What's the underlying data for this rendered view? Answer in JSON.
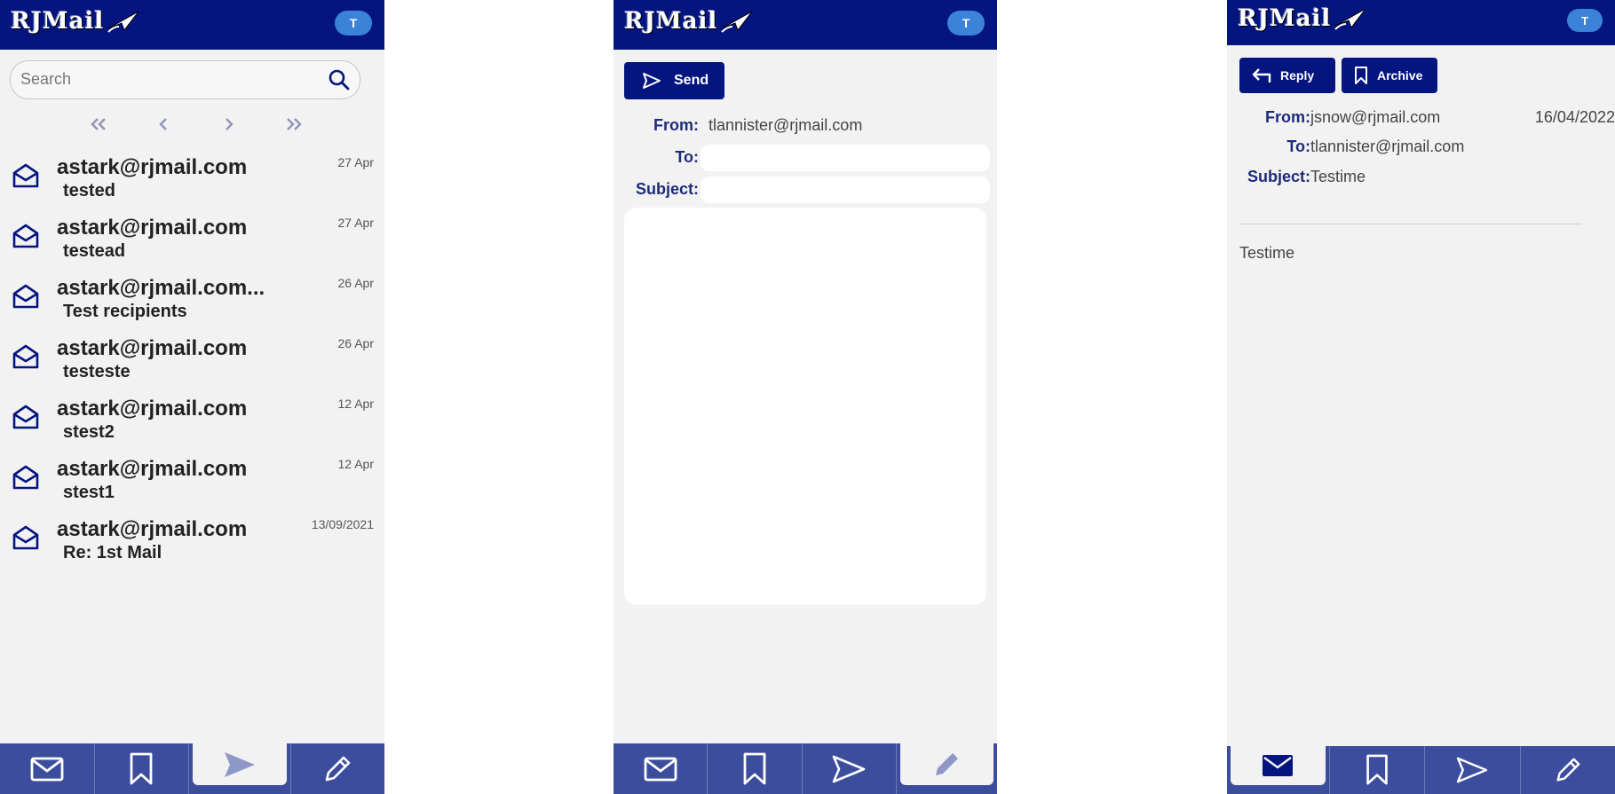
{
  "app": {
    "name": "RJMail",
    "avatar_initial": "T"
  },
  "inbox": {
    "search_placeholder": "Search",
    "messages": [
      {
        "from": "astark@rjmail.com",
        "subject": "tested",
        "date": "27 Apr"
      },
      {
        "from": "astark@rjmail.com",
        "subject": "testead",
        "date": "27 Apr"
      },
      {
        "from": "astark@rjmail.com...",
        "subject": "Test recipients",
        "date": "26 Apr"
      },
      {
        "from": "astark@rjmail.com",
        "subject": "testeste",
        "date": "26 Apr"
      },
      {
        "from": "astark@rjmail.com",
        "subject": "stest2",
        "date": "12 Apr"
      },
      {
        "from": "astark@rjmail.com",
        "subject": "stest1",
        "date": "12 Apr"
      },
      {
        "from": "astark@rjmail.com",
        "subject": "Re: 1st Mail",
        "date": "13/09/2021"
      }
    ]
  },
  "compose": {
    "send_label": "Send",
    "from_label": "From:",
    "from_value": "tlannister@rjmail.com",
    "to_label": "To:",
    "to_value": "",
    "subject_label": "Subject:",
    "subject_value": "",
    "body": ""
  },
  "read": {
    "reply_label": "Reply",
    "archive_label": "Archive",
    "from_label": "From:",
    "from_value": "jsnow@rjmail.com",
    "date": "16/04/2022",
    "to_label": "To:",
    "to_value": "tlannister@rjmail.com",
    "subject_label": "Subject:",
    "subject_value": "Testime",
    "body": "Testime"
  },
  "nav": {
    "tabs": [
      "inbox",
      "archive",
      "sent",
      "compose"
    ],
    "active": {
      "inbox_panel": "sent",
      "compose_panel": "compose",
      "read_panel": "inbox"
    }
  },
  "colors": {
    "brand": "#041580",
    "nav": "#3d4d9e",
    "avatar": "#3b82d9",
    "background": "#f2f2f2"
  }
}
